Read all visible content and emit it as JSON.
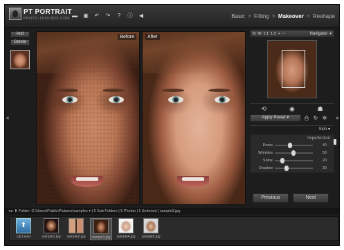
{
  "app": {
    "title": "PT PORTRAIT",
    "subtitle": "PHOTO-TOOLBOX.COM"
  },
  "toolbar": {
    "icons": [
      "folder-icon",
      "save-icon",
      "undo-icon",
      "redo-icon",
      "help-icon",
      "info-icon",
      "back-icon"
    ],
    "glyphs": [
      "▬",
      "▣",
      "↶",
      "↷",
      "?",
      "ⓘ",
      "◀"
    ]
  },
  "workflow": {
    "steps": [
      "Basic",
      "Fitting",
      "Makeover",
      "Reshape"
    ],
    "separator": ">",
    "active_index": 2
  },
  "left_panel": {
    "add_label": "Add",
    "delete_label": "Delete"
  },
  "views": {
    "before_label": "Before",
    "after_label": "After"
  },
  "navigator": {
    "zoom_fit": "fit",
    "zoom_fill": "fill",
    "zoom_1_1": "1:1",
    "zoom_1_2": "1:2",
    "zoom_in": "+",
    "zoom_out": "−",
    "title": "Navigator"
  },
  "preset": {
    "apply_label": "Apply Preset"
  },
  "skin": {
    "title": "Skin",
    "group_title": "Imperfection",
    "sliders": [
      {
        "label": "Pores",
        "value": "40"
      },
      {
        "label": "Wrinkles",
        "value": "50"
      },
      {
        "label": "Shine",
        "value": "20"
      },
      {
        "label": "Shadow",
        "value": "30"
      }
    ]
  },
  "navigation": {
    "previous_label": "Previous",
    "next_label": "Next"
  },
  "folder": {
    "label": "Folder:",
    "path": "C:\\Users\\Public\\Pictures\\samples",
    "info": "| 0 Sub Folders | 5 Photos | 1 Selected | sample3.jpg"
  },
  "filmstrip": {
    "items": [
      {
        "caption": "Up Level"
      },
      {
        "caption": "sample1.jpg"
      },
      {
        "caption": "sample2.jpg"
      },
      {
        "caption": "sample3.jpg"
      },
      {
        "caption": "sample4.jpg"
      },
      {
        "caption": "sample5.jpg"
      }
    ],
    "selected_index": 3
  },
  "colors": {
    "background": "#1d1d1d",
    "panel": "#2b2b2b",
    "text": "#d8d8d8",
    "accent": "#ffffff"
  }
}
